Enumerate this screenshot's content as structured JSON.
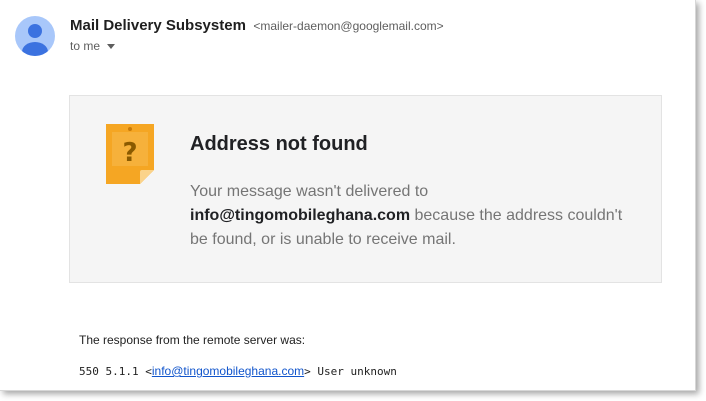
{
  "sender": {
    "name": "Mail Delivery Subsystem",
    "email": "<mailer-daemon@googlemail.com>",
    "avatar_icon": "person-avatar-icon"
  },
  "recipient": {
    "label": "to me",
    "toggle_icon": "caret-down-icon"
  },
  "notice": {
    "icon": "question-note-icon",
    "title": "Address not found",
    "body_prefix": "Your message wasn't delivered to ",
    "address": "info@tingomobileghana.com",
    "body_suffix": " because the address couldn't be found, or is unable to receive mail."
  },
  "response": {
    "label": "The response from the remote server was:",
    "code": "550 5.1.1 <",
    "link": "info@tingomobileghana.com",
    "tail": "> User unknown"
  },
  "colors": {
    "avatar_bg": "#a8c7fa",
    "avatar_fg": "#3b72e0",
    "icon_orange": "#f5a623",
    "link": "#1155cc"
  }
}
